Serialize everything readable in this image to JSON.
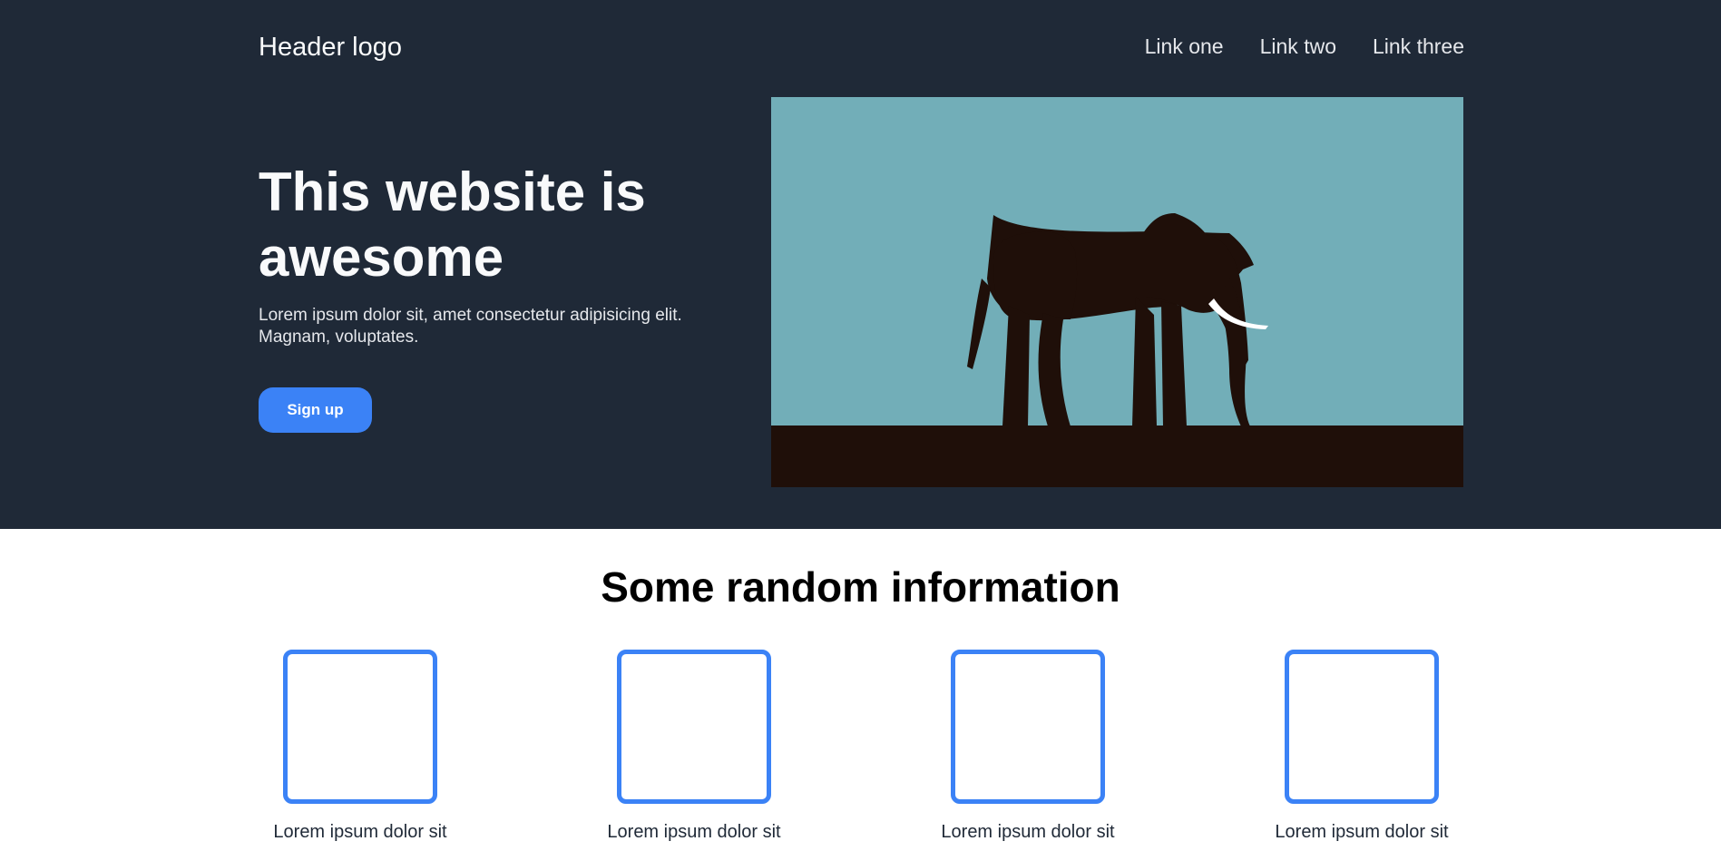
{
  "header": {
    "logo": "Header logo",
    "links": [
      "Link one",
      "Link two",
      "Link three"
    ]
  },
  "hero": {
    "title": "This website is awesome",
    "text": "Lorem ipsum dolor sit, amet consectetur adipisicing elit. Magnam, voluptates.",
    "button_label": "Sign up",
    "image_icon": "elephant-silhouette",
    "colors": {
      "background": "#1f2937",
      "sky": "#72aeb8",
      "ground": "#1f0f09",
      "accent": "#3b82f6"
    }
  },
  "info": {
    "title": "Some random information",
    "cards": [
      {
        "text": "Lorem ipsum dolor sit"
      },
      {
        "text": "Lorem ipsum dolor sit"
      },
      {
        "text": "Lorem ipsum dolor sit"
      },
      {
        "text": "Lorem ipsum dolor sit"
      }
    ]
  }
}
